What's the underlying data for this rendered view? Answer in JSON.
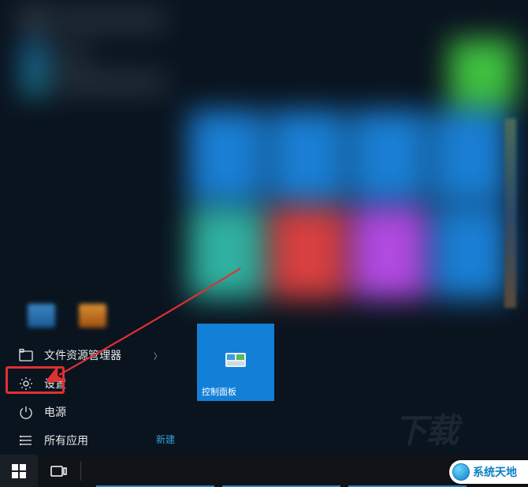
{
  "nav": {
    "file_explorer": "文件资源管理器",
    "settings": "设置",
    "power": "电源",
    "all_apps": "所有应用"
  },
  "tile": {
    "control_panel": "控制面板"
  },
  "section": {
    "new": "新建"
  },
  "watermark": {
    "left_text": "下载",
    "badge_text": "系统天地"
  }
}
